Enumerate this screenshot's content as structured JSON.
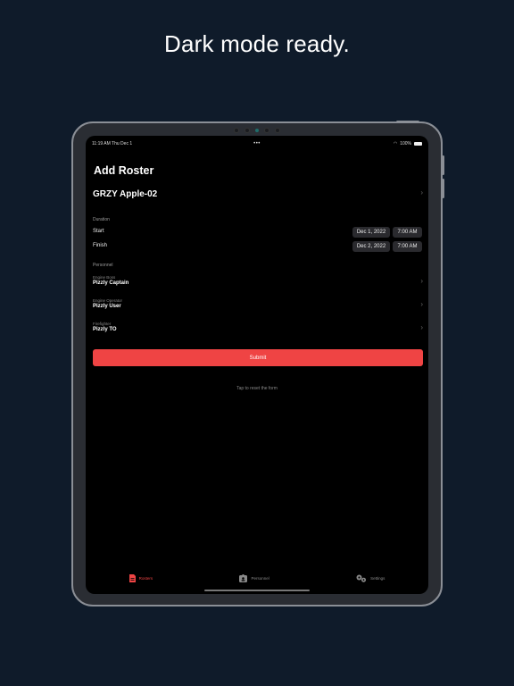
{
  "headline": "Dark mode ready.",
  "status_bar": {
    "time_date": "11:19 AM  Thu Dec 1",
    "center_dots": "•••",
    "battery_text": "100%"
  },
  "page_title": "Add Roster",
  "roster_name": "GRZY Apple-02",
  "duration": {
    "section_label": "Duration",
    "start_label": "Start",
    "start_date": "Dec 1, 2022",
    "start_time": "7:00 AM",
    "finish_label": "Finish",
    "finish_date": "Dec 2, 2022",
    "finish_time": "7:00 AM"
  },
  "personnel": {
    "section_label": "Personnel",
    "items": [
      {
        "role": "Engine Boss",
        "name": "Pizzly Captain"
      },
      {
        "role": "Engine Operator",
        "name": "Pizzly User"
      },
      {
        "role": "Firefighter",
        "name": "Pizzly TO"
      }
    ]
  },
  "submit_label": "Submit",
  "reset_text": "Tap to reset the form",
  "tabs": [
    {
      "label": "Rosters",
      "icon": "document-icon",
      "active": true
    },
    {
      "label": "Personnel",
      "icon": "id-badge-icon",
      "active": false
    },
    {
      "label": "Settings",
      "icon": "gears-icon",
      "active": false
    }
  ],
  "colors": {
    "accent": "#ef4444",
    "background": "#0f1b2a",
    "screen": "#000000"
  }
}
